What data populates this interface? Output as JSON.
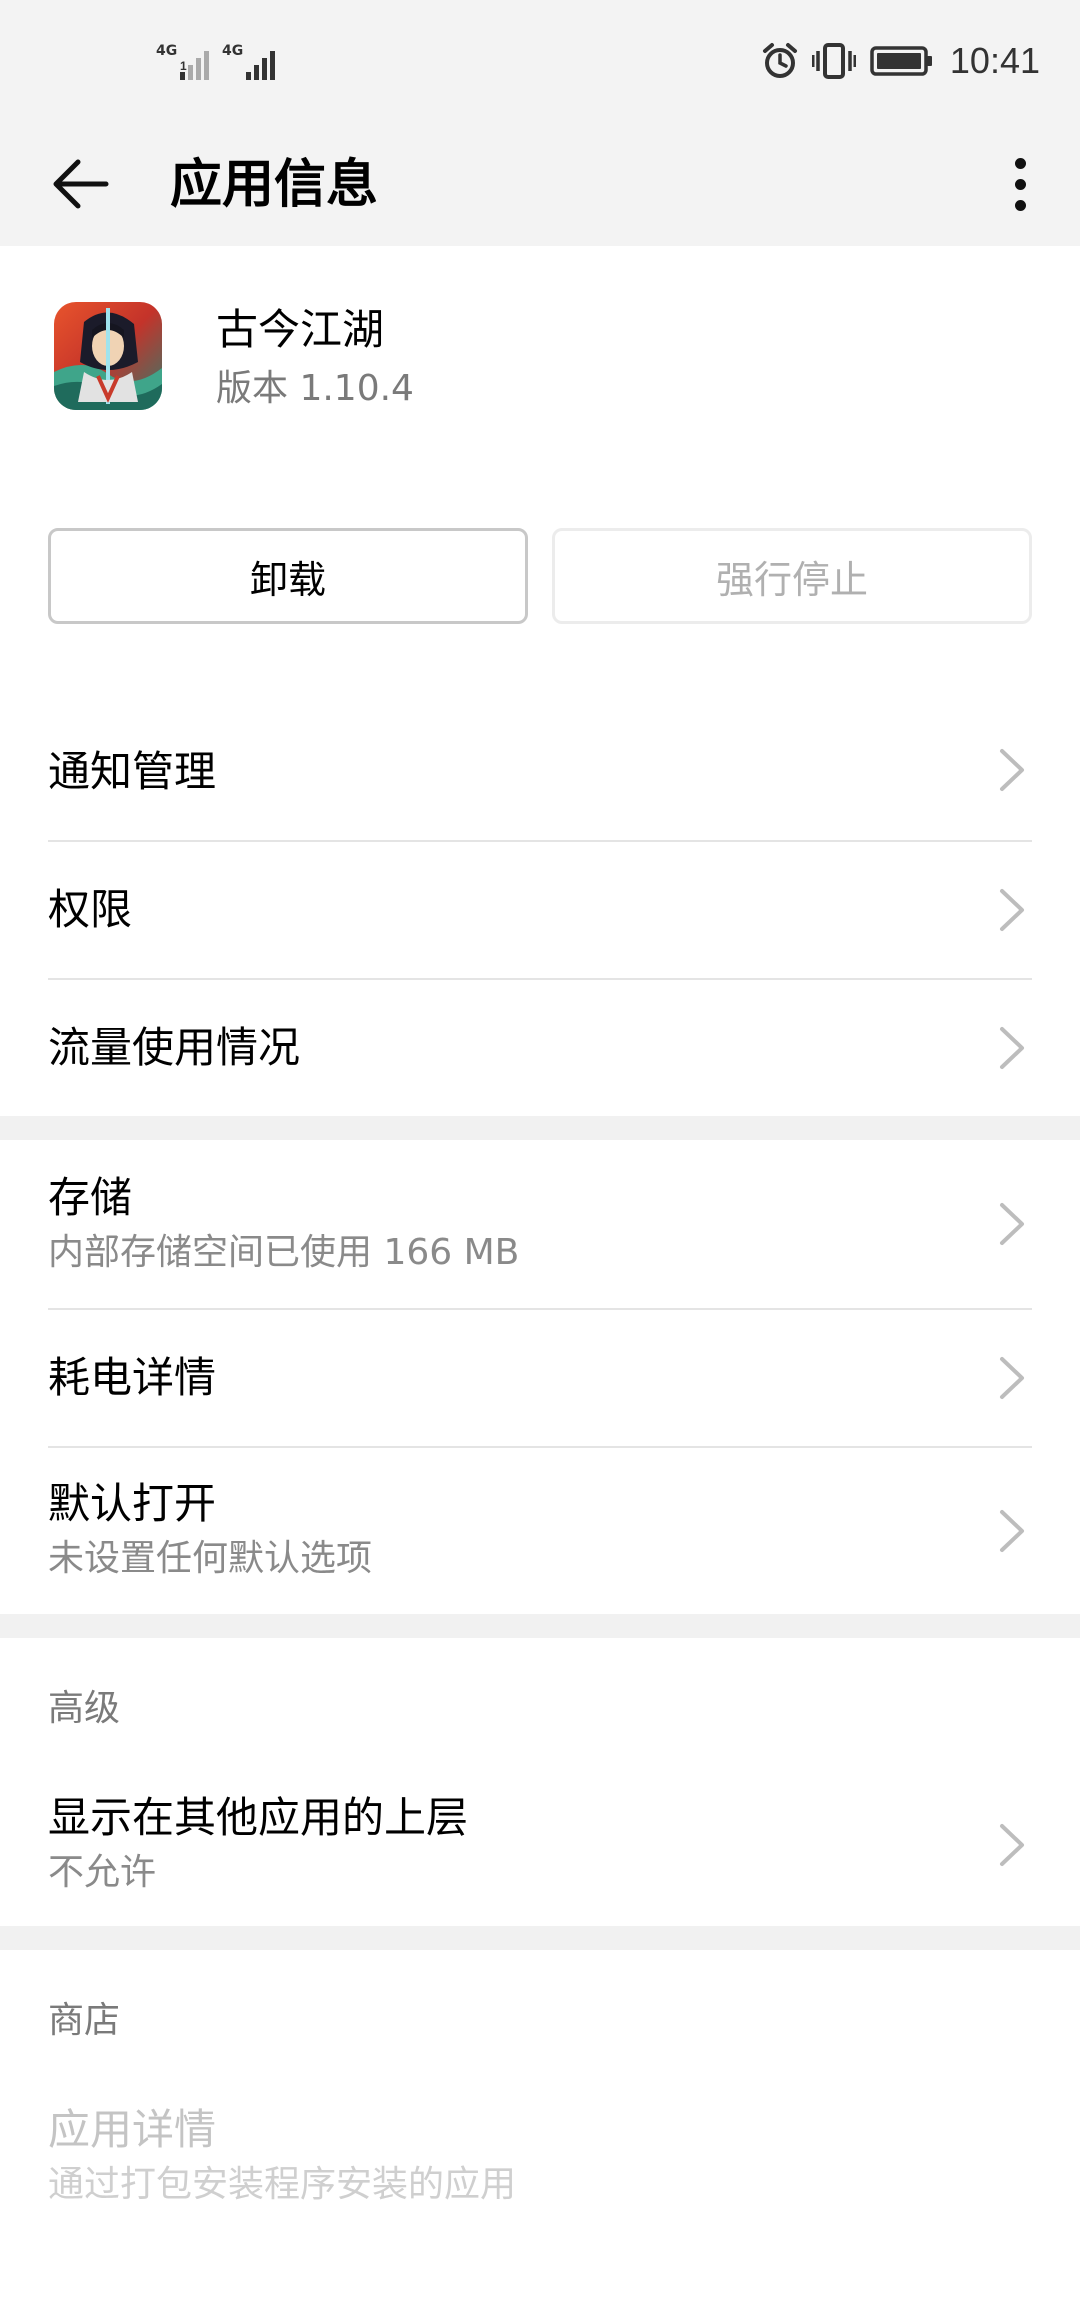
{
  "status_bar": {
    "signal_1_tag": "4G",
    "signal_2_tag": "4G",
    "icons": [
      "alarm-icon",
      "vibrate-icon",
      "battery-icon"
    ],
    "time": "10:41"
  },
  "header": {
    "title": "应用信息",
    "back_icon": "arrow-left-icon",
    "menu_icon": "more-vertical-icon"
  },
  "app": {
    "name": "古今江湖",
    "version": "版本 1.10.4"
  },
  "actions": {
    "uninstall_label": "卸载",
    "force_stop_label": "强行停止"
  },
  "group1": {
    "items": [
      {
        "label": "通知管理"
      },
      {
        "label": "权限"
      },
      {
        "label": "流量使用情况"
      }
    ]
  },
  "group2": {
    "items": [
      {
        "label": "存储",
        "sub": "内部存储空间已使用 166 MB"
      },
      {
        "label": "耗电详情"
      },
      {
        "label": "默认打开",
        "sub": "未设置任何默认选项"
      }
    ]
  },
  "advanced": {
    "title": "高级",
    "items": [
      {
        "label": "显示在其他应用的上层",
        "sub": "不允许"
      }
    ]
  },
  "store": {
    "title": "商店",
    "items": [
      {
        "label": "应用详情",
        "sub": "通过打包安装程序安装的应用"
      }
    ]
  },
  "colors": {
    "background": "#ffffff",
    "header_bg": "#f3f3f3",
    "section_gap": "#f1f1f1",
    "secondary_text": "#8a8a8a",
    "disabled_text": "#c4c4c4"
  }
}
